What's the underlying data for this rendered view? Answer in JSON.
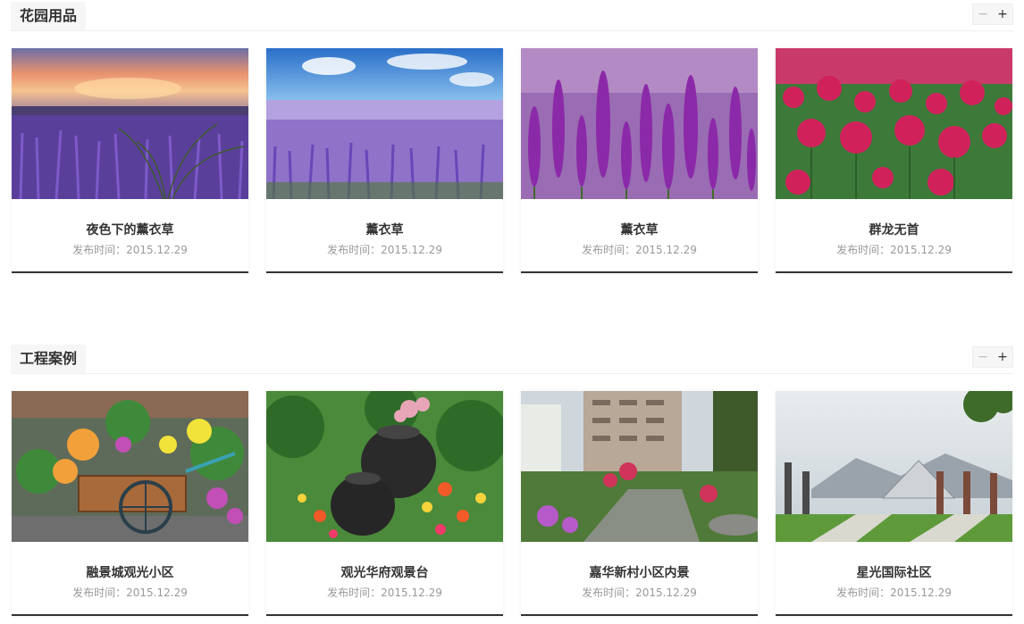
{
  "sections": [
    {
      "title": "花园用品",
      "controls": {
        "minus": "−",
        "plus": "+"
      },
      "items": [
        {
          "title": "夜色下的薰衣草",
          "date": "发布时间：2015.12.29"
        },
        {
          "title": "薰衣草",
          "date": "发布时间：2015.12.29"
        },
        {
          "title": "薰衣草",
          "date": "发布时间：2015.12.29"
        },
        {
          "title": "群龙无首",
          "date": "发布时间：2015.12.29"
        }
      ]
    },
    {
      "title": "工程案例",
      "controls": {
        "minus": "−",
        "plus": "+"
      },
      "items": [
        {
          "title": "融景城观光小区",
          "date": "发布时间：2015.12.29"
        },
        {
          "title": "观光华府观景台",
          "date": "发布时间：2015.12.29"
        },
        {
          "title": "嘉华新村小区内景",
          "date": "发布时间：2015.12.29"
        },
        {
          "title": "星光国际社区",
          "date": "发布时间：2015.12.29"
        }
      ]
    }
  ]
}
